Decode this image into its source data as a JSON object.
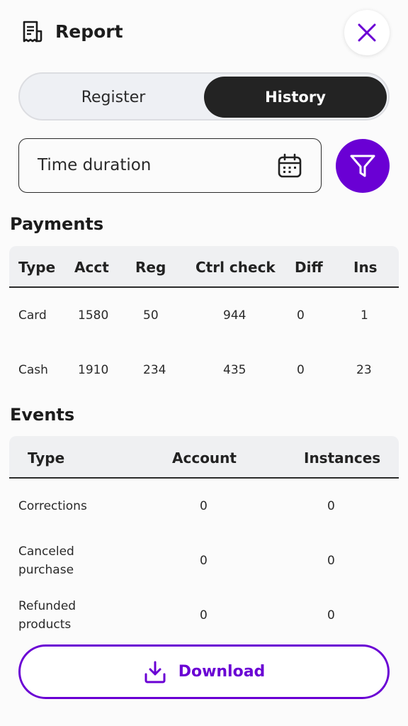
{
  "header": {
    "title": "Report",
    "icon": "receipt-icon",
    "close_icon": "close-icon"
  },
  "tabs": [
    {
      "label": "Register",
      "active": false
    },
    {
      "label": "History",
      "active": true
    }
  ],
  "filter": {
    "duration_label": "Time duration",
    "calendar_icon": "calendar-icon",
    "filter_icon": "filter-icon"
  },
  "payments": {
    "title": "Payments",
    "columns": [
      "Type",
      "Acct",
      "Reg",
      "Ctrl check",
      "Diff",
      "Ins"
    ],
    "rows": [
      [
        "Card",
        "1580",
        "50",
        "944",
        "0",
        "1"
      ],
      [
        "Cash",
        "1910",
        "234",
        "435",
        "0",
        "23"
      ]
    ]
  },
  "events": {
    "title": "Events",
    "columns": [
      "Type",
      "Account",
      "Instances"
    ],
    "rows": [
      {
        "type_line1": "Corrections",
        "type_line2": "",
        "account": "0",
        "instances": "0"
      },
      {
        "type_line1": "Canceled",
        "type_line2": "purchase",
        "account": "0",
        "instances": "0"
      },
      {
        "type_line1": "Refunded",
        "type_line2": "products",
        "account": "0",
        "instances": "0"
      }
    ]
  },
  "download": {
    "label": "Download",
    "icon": "download-icon"
  },
  "colors": {
    "accent": "#6a00d4",
    "dark": "#232323"
  }
}
